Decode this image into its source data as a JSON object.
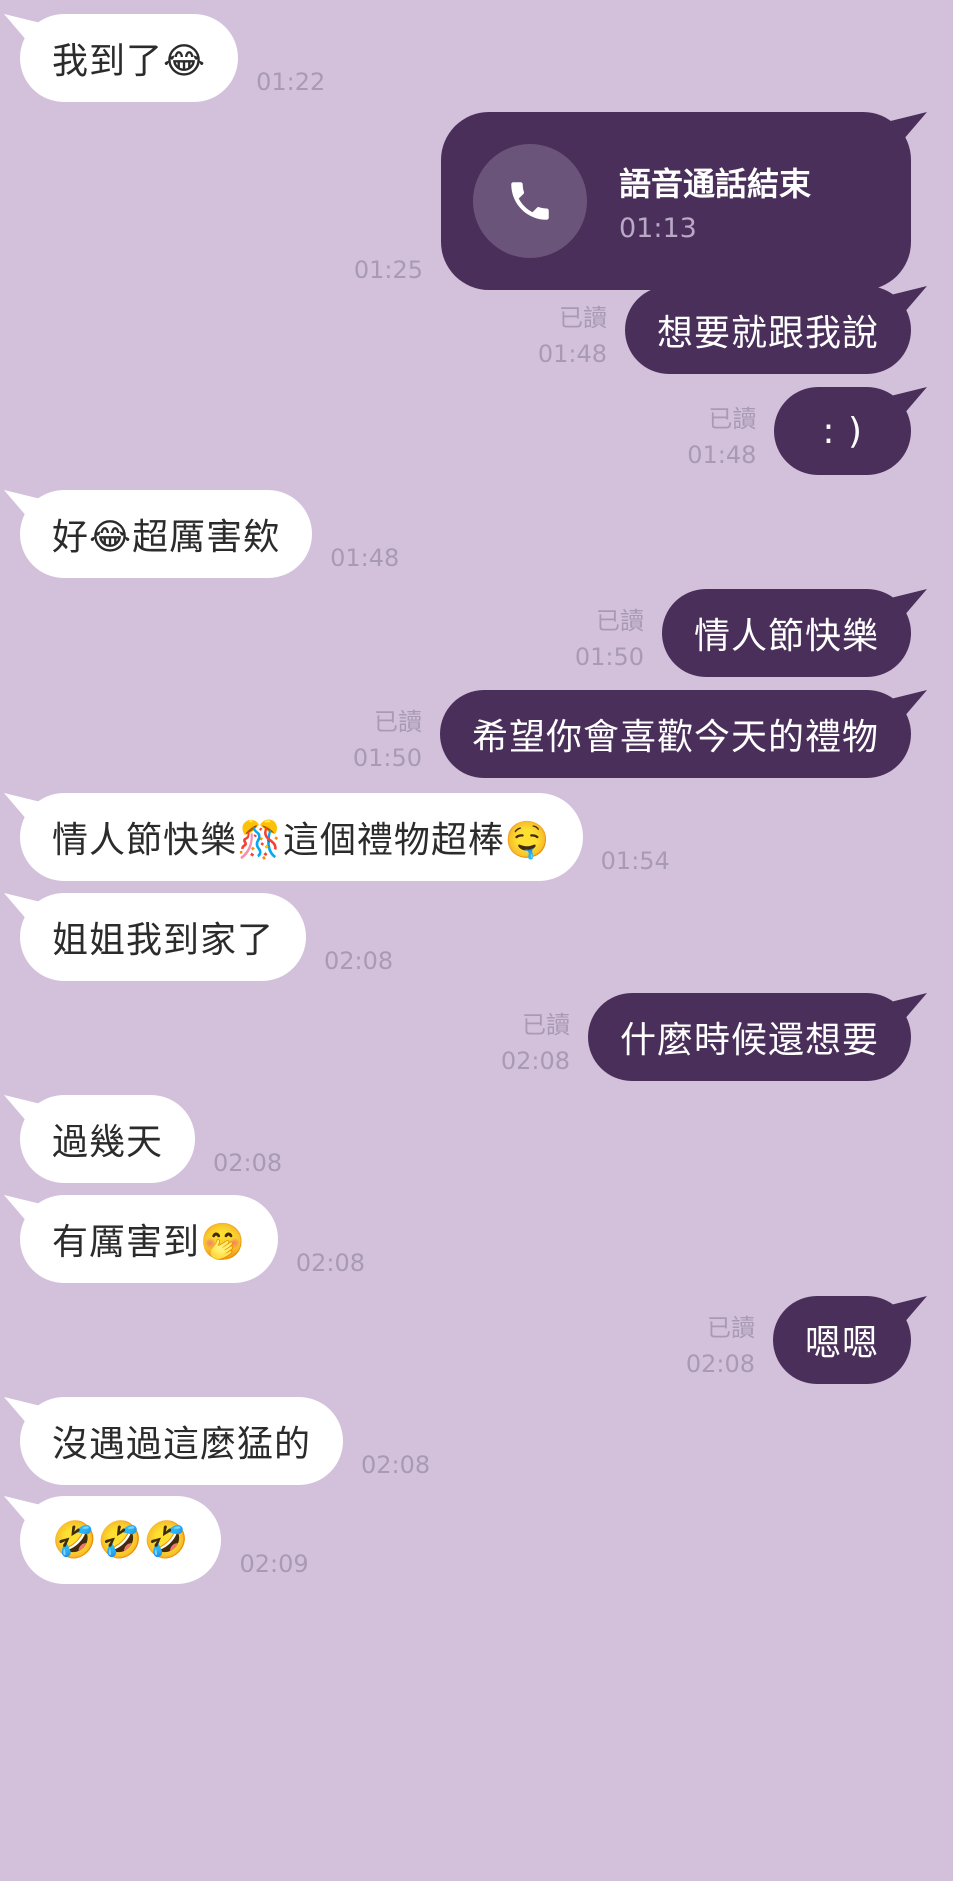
{
  "colors": {
    "background": "#d3c1dc",
    "incoming_bubble": "#ffffff",
    "outgoing_bubble": "#4a2f5a",
    "meta_text": "#a99ab4"
  },
  "messages": [
    {
      "dir": "in",
      "text": "我到了😂",
      "time": "01:22"
    },
    {
      "dir": "out",
      "type": "call",
      "call_title": "語音通話結束",
      "call_duration": "01:13",
      "time": "01:25",
      "icon": "phone-icon"
    },
    {
      "dir": "out",
      "text": "想要就跟我說",
      "read": "已讀",
      "time": "01:48"
    },
    {
      "dir": "out",
      "text": ": )",
      "read": "已讀",
      "time": "01:48"
    },
    {
      "dir": "in",
      "text": "好😂超厲害欸",
      "time": "01:48"
    },
    {
      "dir": "out",
      "text": "情人節快樂",
      "read": "已讀",
      "time": "01:50"
    },
    {
      "dir": "out",
      "text": "希望你會喜歡今天的禮物",
      "read": "已讀",
      "time": "01:50"
    },
    {
      "dir": "in",
      "text": "情人節快樂🎊這個禮物超棒🤤",
      "time": "01:54"
    },
    {
      "dir": "in",
      "text": "姐姐我到家了",
      "time": "02:08"
    },
    {
      "dir": "out",
      "text": "什麼時候還想要",
      "read": "已讀",
      "time": "02:08"
    },
    {
      "dir": "in",
      "text": "過幾天",
      "time": "02:08"
    },
    {
      "dir": "in",
      "text": "有厲害到🤭",
      "time": "02:08"
    },
    {
      "dir": "out",
      "text": "嗯嗯",
      "read": "已讀",
      "time": "02:08"
    },
    {
      "dir": "in",
      "text": "沒遇過這麼猛的",
      "time": "02:08"
    },
    {
      "dir": "in",
      "text": "🤣🤣🤣",
      "time": "02:09"
    }
  ]
}
